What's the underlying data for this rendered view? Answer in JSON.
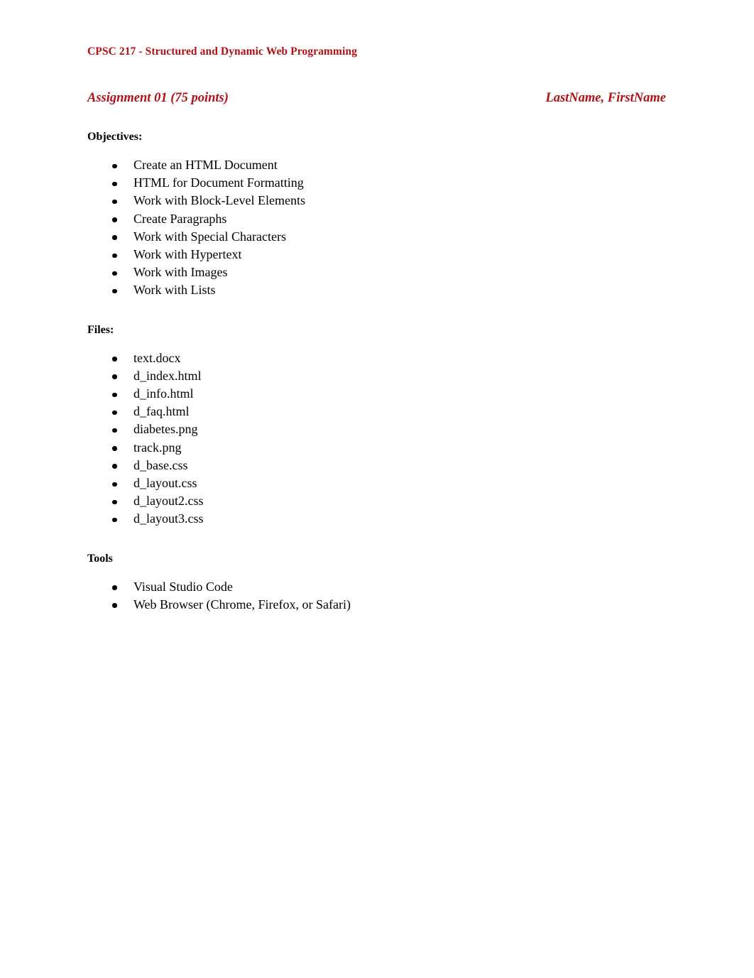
{
  "document": {
    "course_title": "CPSC 217 - Structured and Dynamic Web Programming",
    "assignment_title": "Assignment 01 (75 points)",
    "student_name": "LastName, FirstName",
    "accent_color": "#B01116",
    "text_color": "#000000",
    "background_color": "#FFFFFF"
  },
  "sections": {
    "objectives": {
      "heading": "Objectives:",
      "items": [
        "Create an HTML Document",
        "HTML for Document Formatting",
        "Work with Block-Level Elements",
        "Create Paragraphs",
        "Work with Special Characters",
        "Work with Hypertext",
        "Work with Images",
        "Work with Lists"
      ]
    },
    "files": {
      "heading": "Files:",
      "items": [
        "text.docx",
        "d_index.html",
        "d_info.html",
        "d_faq.html",
        "diabetes.png",
        "track.png",
        "d_base.css",
        "d_layout.css",
        "d_layout2.css",
        "d_layout3.css"
      ]
    },
    "tools": {
      "heading": "Tools",
      "items": [
        "Visual Studio Code",
        "Web Browser (Chrome, Firefox, or Safari)"
      ]
    }
  }
}
